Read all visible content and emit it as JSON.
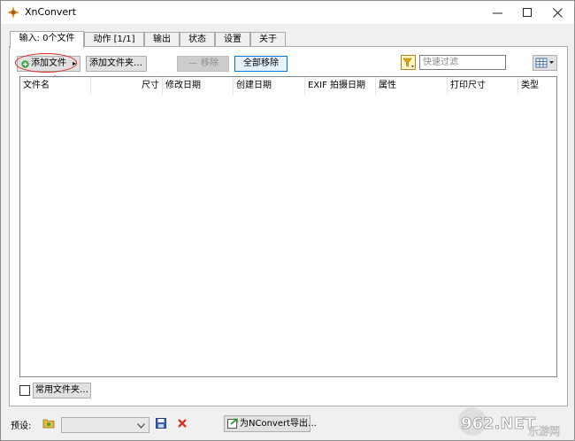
{
  "window": {
    "title": "XnConvert"
  },
  "tabs": [
    {
      "label": "输入: 0个文件",
      "active": true
    },
    {
      "label": "动作 [1/1]",
      "active": false
    },
    {
      "label": "输出",
      "active": false
    },
    {
      "label": "状态",
      "active": false
    },
    {
      "label": "设置",
      "active": false
    },
    {
      "label": "关于",
      "active": false
    }
  ],
  "toolbar": {
    "add_files": "添加文件",
    "add_folder": "添加文件夹…",
    "remove": "移除",
    "remove_all": "全部移除",
    "filter_placeholder": "快速过滤"
  },
  "columns": [
    "文件名",
    "尺寸",
    "修改日期",
    "创建日期",
    "EXIF 拍摄日期",
    "属性",
    "打印尺寸",
    "类型"
  ],
  "favorites": {
    "label": "常用文件夹…"
  },
  "bottom": {
    "preset_label": "预设:",
    "export_label": "为NConvert导出…"
  },
  "watermark": {
    "brand": "962.NET",
    "sub": "乐游网"
  },
  "colors": {
    "accent": "#0078d7",
    "highlight": "#e0201a"
  }
}
